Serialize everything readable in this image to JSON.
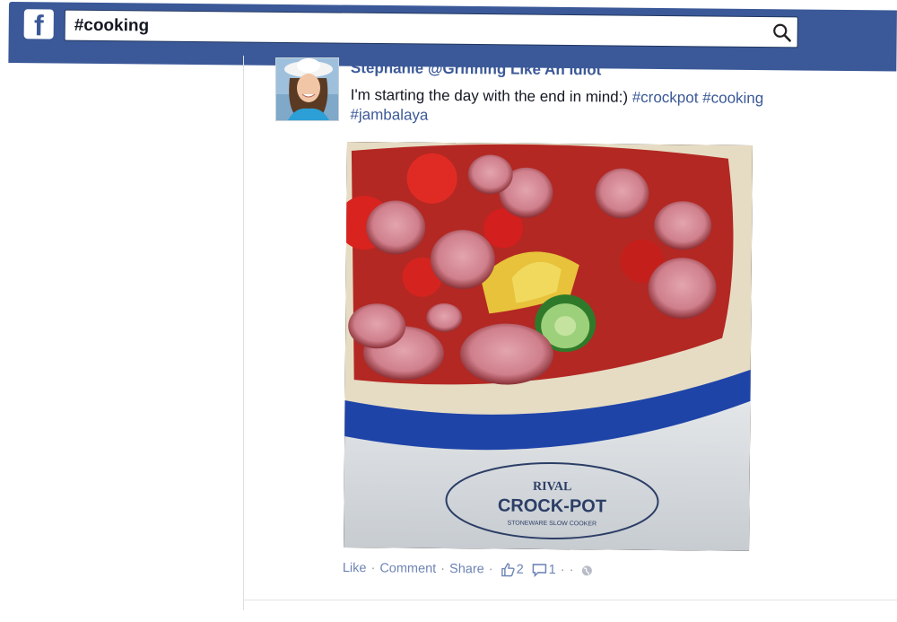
{
  "topbar": {
    "logo_letter": "f",
    "search": {
      "value": "#cooking",
      "placeholder": ""
    }
  },
  "post": {
    "author": "Stephanie @Grinning Like An Idiot",
    "text": "I'm starting the day with the end in mind:) ",
    "hashtags": [
      "#crockpot",
      "#cooking",
      "#jambalaya"
    ],
    "photo": {
      "label_brand": "RIVAL",
      "label_product": "CROCK-POT",
      "label_sub": "STONEWARE SLOW COOKER"
    },
    "actions": {
      "like": "Like",
      "comment": "Comment",
      "share": "Share",
      "like_count": "2",
      "comment_count": "1"
    }
  },
  "colors": {
    "brand": "#3b5998",
    "link": "#6d84b4",
    "meta": "#9197a3",
    "crock_blue": "#1f44a8"
  },
  "icons": [
    "facebook-logo-icon",
    "search-icon",
    "thumbs-up-icon",
    "comment-icon",
    "globe-icon"
  ]
}
